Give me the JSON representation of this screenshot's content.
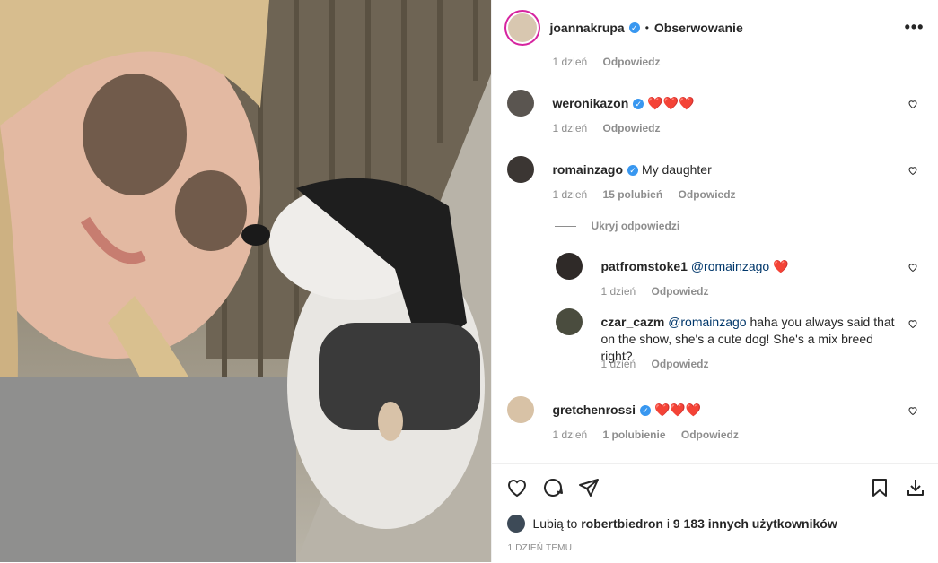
{
  "post": {
    "author": "joannakrupa",
    "follow_label": "Obserwowanie",
    "more_label": "•••"
  },
  "comments": [
    {
      "meta_time": "1 dzień",
      "reply_label": "Odpowiedz"
    },
    {
      "user": "weronikazon",
      "text": "❤️❤️❤️",
      "time": "1 dzień",
      "reply": "Odpowiedz"
    },
    {
      "user": "romainzago",
      "text": "My daughter",
      "time": "1 dzień",
      "likes": "15 polubień",
      "reply": "Odpowiedz",
      "hide_replies": "Ukryj odpowiedzi",
      "replies": [
        {
          "user": "patfromstoke1",
          "mention": "@romainzago",
          "text": "❤️",
          "time": "1 dzień",
          "reply": "Odpowiedz"
        },
        {
          "user": "czar_cazm",
          "mention": "@romainzago",
          "text": "haha you always said that on the show, she's a cute dog! She's a mix breed right?",
          "time": "1 dzień",
          "reply": "Odpowiedz"
        }
      ]
    },
    {
      "user": "gretchenrossi",
      "text": "❤️❤️❤️",
      "time": "1 dzień",
      "likes": "1 polubienie",
      "reply": "Odpowiedz"
    }
  ],
  "likes_line": {
    "prefix": "Lubią to",
    "user": "robertbiedron",
    "connector": "i",
    "others": "9 183 innych użytkowników"
  },
  "post_date": "1 DZIEŃ TEMU",
  "icons": {
    "like": "heart-outline-icon",
    "comment": "comment-bubble-icon",
    "share": "paper-plane-icon",
    "save": "bookmark-icon",
    "download": "download-icon"
  },
  "colors": {
    "verified": "#3897f0",
    "heart": "#e0245e",
    "meta": "#8e8e8e",
    "mention": "#00376b"
  }
}
